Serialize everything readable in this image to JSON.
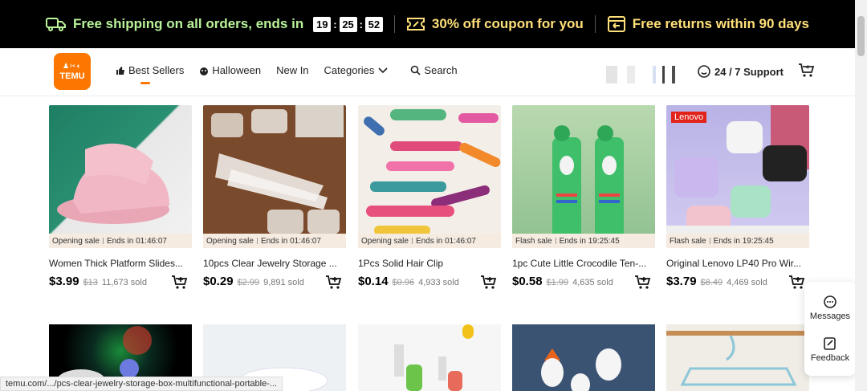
{
  "promo": {
    "shipping_text": "Free shipping on all orders, ends in",
    "timer": {
      "h": "19",
      "m": "25",
      "s": "52"
    },
    "coupon_text": "30% off coupon for you",
    "returns_text": "Free returns within 90 days",
    "colors": {
      "background": "#000000",
      "green": "#b9f39a",
      "yellow": "#ffe07a"
    }
  },
  "header": {
    "logo_text": "TEMU",
    "nav": [
      {
        "label": "Best Sellers",
        "icon": "thumbs-up-icon"
      },
      {
        "label": "Halloween",
        "icon": "pumpkin-icon"
      },
      {
        "label": "New In"
      },
      {
        "label": "Categories",
        "icon": "chevron-down-icon"
      },
      {
        "label": "Search",
        "icon": "search-icon"
      }
    ],
    "support_label": "24 / 7 Support",
    "accent": "#fb7701"
  },
  "products": [
    {
      "title": "Women Thick Platform Slides...",
      "sale_type": "Opening sale",
      "ends": "Ends in 01:46:07",
      "price": "$3.99",
      "old_price": "$13",
      "sold": "11,673 sold"
    },
    {
      "title": "10pcs Clear Jewelry Storage ...",
      "sale_type": "Opening sale",
      "ends": "Ends in 01:46:07",
      "price": "$0.29",
      "old_price": "$2.99",
      "sold": "9,891 sold"
    },
    {
      "title": "1Pcs Solid Hair Clip",
      "sale_type": "Opening sale",
      "ends": "Ends in 01:46:07",
      "price": "$0.14",
      "old_price": "$0.96",
      "sold": "4,933 sold"
    },
    {
      "title": "1pc Cute Little Crocodile Ten-...",
      "sale_type": "Flash sale",
      "ends": "Ends in 19:25:45",
      "price": "$0.58",
      "old_price": "$1.99",
      "sold": "4,635 sold"
    },
    {
      "title": "Original Lenovo LP40 Pro Wir...",
      "sale_type": "Flash sale",
      "ends": "Ends in 19:25:45",
      "price": "$3.79",
      "old_price": "$8.49",
      "sold": "4,469 sold",
      "brand_badge": "Lenovo"
    }
  ],
  "float_panel": {
    "messages": "Messages",
    "feedback": "Feedback"
  },
  "status_url": "temu.com/.../pcs-clear-jewelry-storage-box-multifunctional-portable-..."
}
